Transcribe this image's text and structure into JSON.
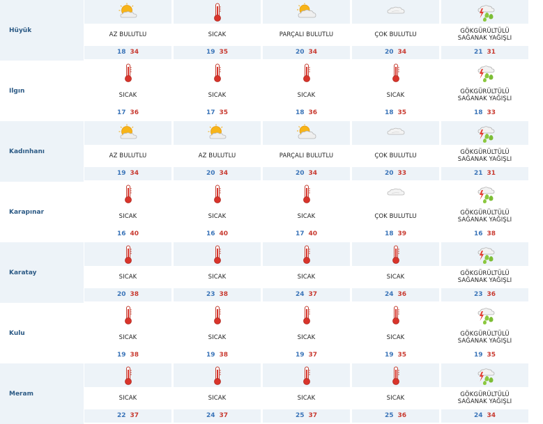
{
  "rows": [
    {
      "city": "Hüyük",
      "days": [
        {
          "icon": "partly-sunny-icon",
          "desc": "AZ BULUTLU",
          "min": "18",
          "max": "34"
        },
        {
          "icon": "thermometer-icon",
          "desc": "SICAK",
          "min": "19",
          "max": "35"
        },
        {
          "icon": "partly-cloudy-icon",
          "desc": "PARÇALI BULUTLU",
          "min": "20",
          "max": "34"
        },
        {
          "icon": "cloud-icon",
          "desc": "ÇOK BULUTLU",
          "min": "20",
          "max": "34"
        },
        {
          "icon": "thunderstorm-icon",
          "desc": "GÖKGÜRÜLTÜLÜ SAĞANAK YAĞIŞLI",
          "min": "21",
          "max": "31"
        }
      ]
    },
    {
      "city": "Ilgın",
      "days": [
        {
          "icon": "thermometer-icon",
          "desc": "SICAK",
          "min": "17",
          "max": "36"
        },
        {
          "icon": "thermometer-icon",
          "desc": "SICAK",
          "min": "17",
          "max": "35"
        },
        {
          "icon": "thermometer-icon",
          "desc": "SICAK",
          "min": "18",
          "max": "36"
        },
        {
          "icon": "thermometer-icon",
          "desc": "SICAK",
          "min": "18",
          "max": "35"
        },
        {
          "icon": "thunderstorm-icon",
          "desc": "GÖKGÜRÜLTÜLÜ SAĞANAK YAĞIŞLI",
          "min": "18",
          "max": "33"
        }
      ]
    },
    {
      "city": "Kadınhanı",
      "days": [
        {
          "icon": "partly-sunny-icon",
          "desc": "AZ BULUTLU",
          "min": "19",
          "max": "34"
        },
        {
          "icon": "partly-sunny-icon",
          "desc": "AZ BULUTLU",
          "min": "20",
          "max": "34"
        },
        {
          "icon": "partly-cloudy-icon",
          "desc": "PARÇALI BULUTLU",
          "min": "20",
          "max": "34"
        },
        {
          "icon": "cloud-icon",
          "desc": "ÇOK BULUTLU",
          "min": "20",
          "max": "33"
        },
        {
          "icon": "thunderstorm-icon",
          "desc": "GÖKGÜRÜLTÜLÜ SAĞANAK YAĞIŞLI",
          "min": "21",
          "max": "31"
        }
      ]
    },
    {
      "city": "Karapınar",
      "days": [
        {
          "icon": "thermometer-icon",
          "desc": "SICAK",
          "min": "16",
          "max": "40"
        },
        {
          "icon": "thermometer-icon",
          "desc": "SICAK",
          "min": "16",
          "max": "40"
        },
        {
          "icon": "thermometer-icon",
          "desc": "SICAK",
          "min": "17",
          "max": "40"
        },
        {
          "icon": "cloud-icon",
          "desc": "ÇOK BULUTLU",
          "min": "18",
          "max": "39"
        },
        {
          "icon": "thunderstorm-icon",
          "desc": "GÖKGÜRÜLTÜLÜ SAĞANAK YAĞIŞLI",
          "min": "16",
          "max": "38"
        }
      ]
    },
    {
      "city": "Karatay",
      "days": [
        {
          "icon": "thermometer-icon",
          "desc": "SICAK",
          "min": "20",
          "max": "38"
        },
        {
          "icon": "thermometer-icon",
          "desc": "SICAK",
          "min": "23",
          "max": "38"
        },
        {
          "icon": "thermometer-icon",
          "desc": "SICAK",
          "min": "24",
          "max": "37"
        },
        {
          "icon": "thermometer-icon",
          "desc": "SICAK",
          "min": "24",
          "max": "36"
        },
        {
          "icon": "thunderstorm-icon",
          "desc": "GÖKGÜRÜLTÜLÜ SAĞANAK YAĞIŞLI",
          "min": "23",
          "max": "36"
        }
      ]
    },
    {
      "city": "Kulu",
      "days": [
        {
          "icon": "thermometer-icon",
          "desc": "SICAK",
          "min": "19",
          "max": "38"
        },
        {
          "icon": "thermometer-icon",
          "desc": "SICAK",
          "min": "19",
          "max": "38"
        },
        {
          "icon": "thermometer-icon",
          "desc": "SICAK",
          "min": "19",
          "max": "37"
        },
        {
          "icon": "thermometer-icon",
          "desc": "SICAK",
          "min": "19",
          "max": "35"
        },
        {
          "icon": "thunderstorm-icon",
          "desc": "GÖKGÜRÜLTÜLÜ SAĞANAK YAĞIŞLI",
          "min": "19",
          "max": "35"
        }
      ]
    },
    {
      "city": "Meram",
      "days": [
        {
          "icon": "thermometer-icon",
          "desc": "SICAK",
          "min": "22",
          "max": "37"
        },
        {
          "icon": "thermometer-icon",
          "desc": "SICAK",
          "min": "24",
          "max": "37"
        },
        {
          "icon": "thermometer-icon",
          "desc": "SICAK",
          "min": "25",
          "max": "37"
        },
        {
          "icon": "thermometer-icon",
          "desc": "SICAK",
          "min": "25",
          "max": "36"
        },
        {
          "icon": "thunderstorm-icon",
          "desc": "GÖKGÜRÜLTÜLÜ SAĞANAK YAĞIŞLI",
          "min": "24",
          "max": "34"
        }
      ]
    }
  ],
  "colors": {
    "min_temp": "#3a74b8",
    "max_temp": "#c83a30",
    "city": "#2c5a85",
    "shade": "#edf3f8"
  }
}
